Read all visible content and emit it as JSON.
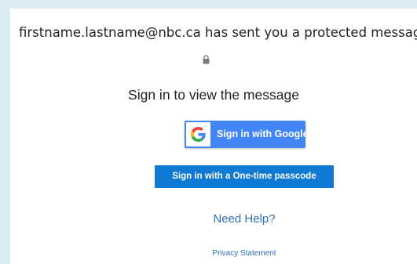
{
  "message": {
    "sender_email": "firstname.lastname@nbc.ca",
    "sender_suffix": "has sent you a protected message",
    "lock_icon": "lock-icon",
    "sign_in_prompt": "Sign in to view the message"
  },
  "actions": {
    "google_button_label": "Sign in with Google",
    "google_icon": "google-g-icon",
    "otp_button_label": "Sign in with a One-time passcode"
  },
  "links": {
    "help": "Need Help?",
    "privacy": "Privacy Statement"
  },
  "colors": {
    "page_background": "#dcecf4",
    "card_background": "#ffffff",
    "google_blue": "#4285f4",
    "otp_blue": "#0f7ad4",
    "link_blue": "#2f6fb7"
  }
}
